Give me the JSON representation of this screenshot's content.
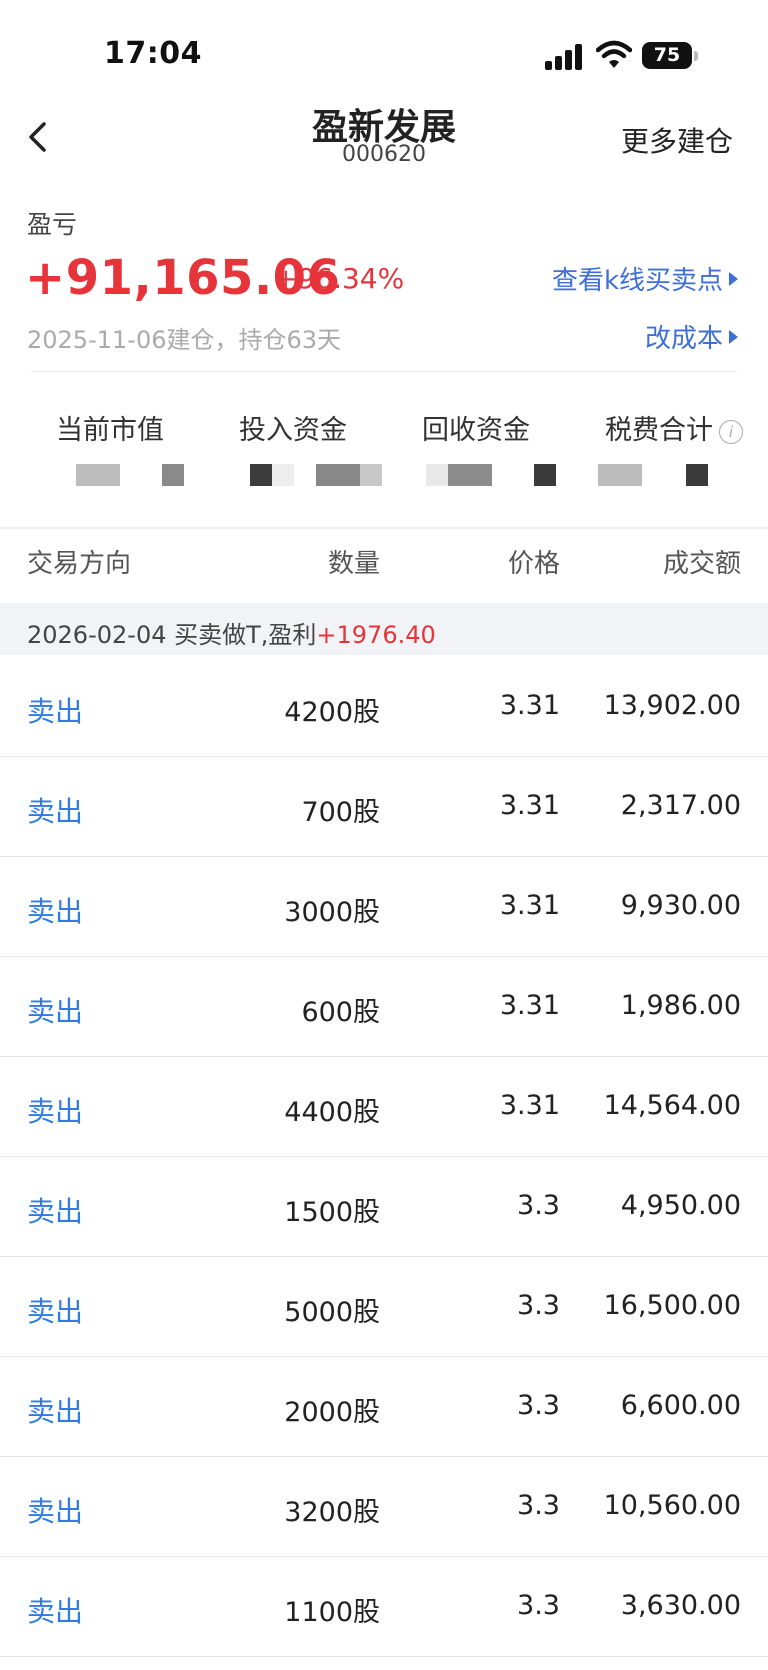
{
  "status_bar": {
    "time": "17:04",
    "battery": "75"
  },
  "header": {
    "title": "盈新发展",
    "code": "000620",
    "more_action": "更多建仓"
  },
  "pnl": {
    "label": "盈亏",
    "value": "+91,165.06",
    "percent": "+96.34%",
    "kline_link": "查看k线买卖点",
    "cost_link": "改成本",
    "build_info": "2025-11-06建仓，持仓63天"
  },
  "summary": {
    "market_value": "当前市值",
    "invested": "投入资金",
    "recovered": "回收资金",
    "fees": "税费合计",
    "info_glyph": "i"
  },
  "table": {
    "headers": {
      "direction": "交易方向",
      "quantity": "数量",
      "price": "价格",
      "amount": "成交额"
    },
    "group": {
      "label": "2026-02-04 买卖做T,盈利",
      "profit": "+1976.40"
    },
    "rows": [
      {
        "direction": "卖出",
        "quantity": "4200股",
        "price": "3.31",
        "amount": "13,902.00"
      },
      {
        "direction": "卖出",
        "quantity": "700股",
        "price": "3.31",
        "amount": "2,317.00"
      },
      {
        "direction": "卖出",
        "quantity": "3000股",
        "price": "3.31",
        "amount": "9,930.00"
      },
      {
        "direction": "卖出",
        "quantity": "600股",
        "price": "3.31",
        "amount": "1,986.00"
      },
      {
        "direction": "卖出",
        "quantity": "4400股",
        "price": "3.31",
        "amount": "14,564.00"
      },
      {
        "direction": "卖出",
        "quantity": "1500股",
        "price": "3.3",
        "amount": "4,950.00"
      },
      {
        "direction": "卖出",
        "quantity": "5000股",
        "price": "3.3",
        "amount": "16,500.00"
      },
      {
        "direction": "卖出",
        "quantity": "2000股",
        "price": "3.3",
        "amount": "6,600.00"
      },
      {
        "direction": "卖出",
        "quantity": "3200股",
        "price": "3.3",
        "amount": "10,560.00"
      },
      {
        "direction": "卖出",
        "quantity": "1100股",
        "price": "3.3",
        "amount": "3,630.00"
      }
    ]
  },
  "colors": {
    "profit_red": "#e6343a",
    "link_blue": "#3d6fd6",
    "sell_blue": "#2f7de1"
  }
}
